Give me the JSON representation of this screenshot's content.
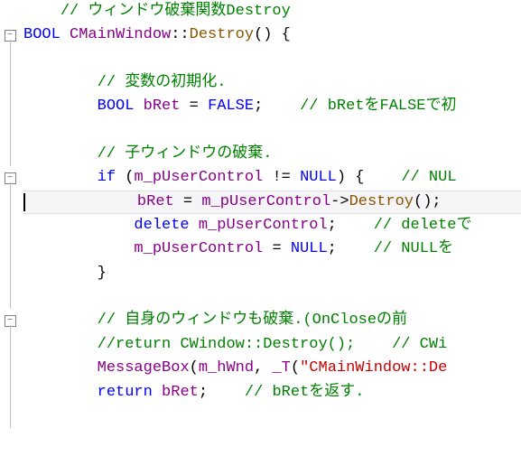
{
  "lines": [
    {
      "indent": "    ",
      "tokens": [
        {
          "cls": "c-comment",
          "t": "// ウィンドウ破棄関数Destroy"
        }
      ]
    },
    {
      "indent": "",
      "tokens": [
        {
          "cls": "c-type",
          "t": "BOOL "
        },
        {
          "cls": "c-ident",
          "t": "CMainWindow"
        },
        {
          "cls": "c-plain",
          "t": "::"
        },
        {
          "cls": "c-brown",
          "t": "Destroy"
        },
        {
          "cls": "c-plain",
          "t": "() {"
        }
      ]
    },
    {
      "indent": "",
      "tokens": []
    },
    {
      "indent": "        ",
      "tokens": [
        {
          "cls": "c-comment",
          "t": "// 変数の初期化."
        }
      ]
    },
    {
      "indent": "        ",
      "tokens": [
        {
          "cls": "c-type",
          "t": "BOOL "
        },
        {
          "cls": "c-ident",
          "t": "bRet"
        },
        {
          "cls": "c-plain",
          "t": " = "
        },
        {
          "cls": "c-type",
          "t": "FALSE"
        },
        {
          "cls": "c-plain",
          "t": ";    "
        },
        {
          "cls": "c-comment",
          "t": "// bRetをFALSEで初"
        }
      ]
    },
    {
      "indent": "",
      "tokens": []
    },
    {
      "indent": "        ",
      "tokens": [
        {
          "cls": "c-comment",
          "t": "// 子ウィンドウの破棄."
        }
      ]
    },
    {
      "indent": "        ",
      "tokens": [
        {
          "cls": "c-keyword",
          "t": "if"
        },
        {
          "cls": "c-plain",
          "t": " ("
        },
        {
          "cls": "c-ident",
          "t": "m_pUserControl"
        },
        {
          "cls": "c-plain",
          "t": " != "
        },
        {
          "cls": "c-type",
          "t": "NULL"
        },
        {
          "cls": "c-plain",
          "t": ") {    "
        },
        {
          "cls": "c-comment",
          "t": "// NUL"
        }
      ]
    },
    {
      "indent": "            ",
      "cursor": true,
      "tokens": [
        {
          "cls": "c-ident",
          "t": "bRet"
        },
        {
          "cls": "c-plain",
          "t": " = "
        },
        {
          "cls": "c-ident",
          "t": "m_pUserControl"
        },
        {
          "cls": "c-plain",
          "t": "->"
        },
        {
          "cls": "c-brown",
          "t": "Destroy"
        },
        {
          "cls": "c-plain",
          "t": "();"
        }
      ]
    },
    {
      "indent": "            ",
      "tokens": [
        {
          "cls": "c-keyword",
          "t": "delete "
        },
        {
          "cls": "c-ident",
          "t": "m_pUserControl"
        },
        {
          "cls": "c-plain",
          "t": ";    "
        },
        {
          "cls": "c-comment",
          "t": "// deleteで"
        }
      ]
    },
    {
      "indent": "            ",
      "tokens": [
        {
          "cls": "c-ident",
          "t": "m_pUserControl"
        },
        {
          "cls": "c-plain",
          "t": " = "
        },
        {
          "cls": "c-type",
          "t": "NULL"
        },
        {
          "cls": "c-plain",
          "t": ";    "
        },
        {
          "cls": "c-comment",
          "t": "// NULLを"
        }
      ]
    },
    {
      "indent": "        ",
      "tokens": [
        {
          "cls": "c-plain",
          "t": "}"
        }
      ]
    },
    {
      "indent": "",
      "tokens": []
    },
    {
      "indent": "        ",
      "tokens": [
        {
          "cls": "c-comment",
          "t": "// 自身のウィンドウも破棄.(OnCloseの前"
        }
      ]
    },
    {
      "indent": "        ",
      "tokens": [
        {
          "cls": "c-comment",
          "t": "//return CWindow::Destroy();    // CWi"
        }
      ]
    },
    {
      "indent": "        ",
      "tokens": [
        {
          "cls": "c-ident",
          "t": "MessageBox"
        },
        {
          "cls": "c-plain",
          "t": "("
        },
        {
          "cls": "c-ident",
          "t": "m_hWnd"
        },
        {
          "cls": "c-plain",
          "t": ", "
        },
        {
          "cls": "c-ident",
          "t": "_T"
        },
        {
          "cls": "c-plain",
          "t": "("
        },
        {
          "cls": "c-string",
          "t": "\"CMainWindow::De"
        }
      ]
    },
    {
      "indent": "        ",
      "tokens": [
        {
          "cls": "c-keyword",
          "t": "return "
        },
        {
          "cls": "c-ident",
          "t": "bRet"
        },
        {
          "cls": "c-plain",
          "t": ";    "
        },
        {
          "cls": "c-comment",
          "t": "// bRetを返す."
        }
      ]
    },
    {
      "indent": "",
      "tokens": []
    }
  ],
  "fold_rows": {
    "1": "minus",
    "7": "minus",
    "13": "minus"
  }
}
